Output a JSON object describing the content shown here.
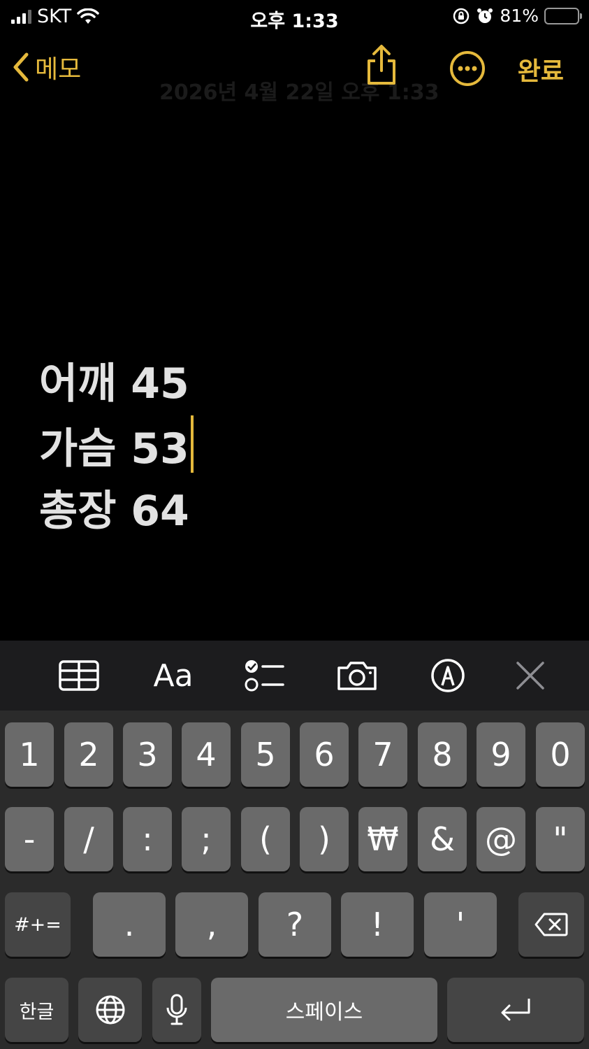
{
  "status_bar": {
    "carrier": "SKT",
    "time": "오후 1:33",
    "battery_percent": "81%",
    "battery_level": 0.81,
    "icons": [
      "signal-icon",
      "wifi-icon",
      "rotation-lock-icon",
      "alarm-icon",
      "battery-charging-icon"
    ]
  },
  "nav": {
    "back_label": "메모",
    "subtitle": "2026년 4월 22일 오후 1:33",
    "done_label": "완료",
    "icons": [
      "chevron-left-icon",
      "share-icon",
      "more-icon"
    ]
  },
  "note": {
    "lines": [
      "어깨 45",
      "가슴 53",
      "총장 64"
    ]
  },
  "toolbar": {
    "items": [
      {
        "name": "table",
        "icon": "table-icon"
      },
      {
        "name": "format",
        "label": "Aa"
      },
      {
        "name": "checklist",
        "icon": "checklist-icon"
      },
      {
        "name": "camera",
        "icon": "camera-icon"
      },
      {
        "name": "markup",
        "icon": "markup-pen-icon"
      },
      {
        "name": "close",
        "icon": "close-icon"
      }
    ]
  },
  "keyboard": {
    "row1": [
      "1",
      "2",
      "3",
      "4",
      "5",
      "6",
      "7",
      "8",
      "9",
      "0"
    ],
    "row2": [
      "-",
      "/",
      ":",
      ";",
      "(",
      ")",
      "₩",
      "&",
      "@",
      "\""
    ],
    "row3": {
      "shift": "#+=",
      "keys": [
        ".",
        ",",
        "?",
        "!",
        "'"
      ],
      "delete_icon": "backspace-icon"
    },
    "row4": {
      "lang": "한글",
      "globe_icon": "globe-icon",
      "mic_icon": "microphone-icon",
      "space": "스페이스",
      "return_icon": "return-icon"
    }
  },
  "colors": {
    "accent": "#e5b93c",
    "background": "#000000",
    "toolbar_bg": "#1c1c1e",
    "keyboard_bg": "#2b2b2b",
    "key_bg": "#6a6a6a",
    "key_dark_bg": "#454545",
    "battery_green": "#34c759"
  }
}
